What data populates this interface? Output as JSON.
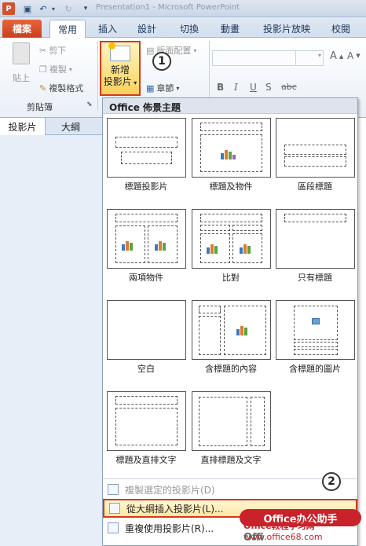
{
  "window": {
    "title": "Presentation1 - Microsoft PowerPoint"
  },
  "app_logo": "P",
  "tabs": [
    "檔案",
    "常用",
    "插入",
    "設計",
    "切換",
    "動畫",
    "投影片放映",
    "校閱"
  ],
  "ribbon": {
    "paste": "貼上",
    "cut": "剪下",
    "copy": "複製",
    "format_painter": "複製格式",
    "clipboard_group": "剪貼簿",
    "new_slide_line1": "新增",
    "new_slide_line2": "投影片",
    "layout": "版面配置",
    "section": "章節",
    "font_bold": "B",
    "font_italic": "I",
    "font_underline": "U",
    "font_strike": "S",
    "font_shadow": "abc"
  },
  "callouts": [
    "1",
    "2"
  ],
  "pane_tabs": [
    "投影片",
    "大綱"
  ],
  "dropdown": {
    "header": "Office 佈景主題",
    "layouts": [
      "標題投影片",
      "標題及物件",
      "區段標題",
      "兩項物件",
      "比對",
      "只有標題",
      "空白",
      "含標題的內容",
      "含標題的圖片",
      "標題及直排文字",
      "直排標題及文字"
    ],
    "menu": [
      {
        "label": "複製選定的投影片(D)",
        "enabled": false
      },
      {
        "label": "從大綱插入投影片(L)...",
        "enabled": true
      },
      {
        "label": "重複使用投影片(R)...",
        "enabled": true
      }
    ]
  },
  "watermark": {
    "line1": "Office办公助手",
    "line2": "Office教程学习网",
    "line3": "www.office68.com",
    "line4": "Offi"
  },
  "colors": {
    "accent": "#d23a1e",
    "file_tab": "#d8532b",
    "highlight": "#fde7a3"
  }
}
